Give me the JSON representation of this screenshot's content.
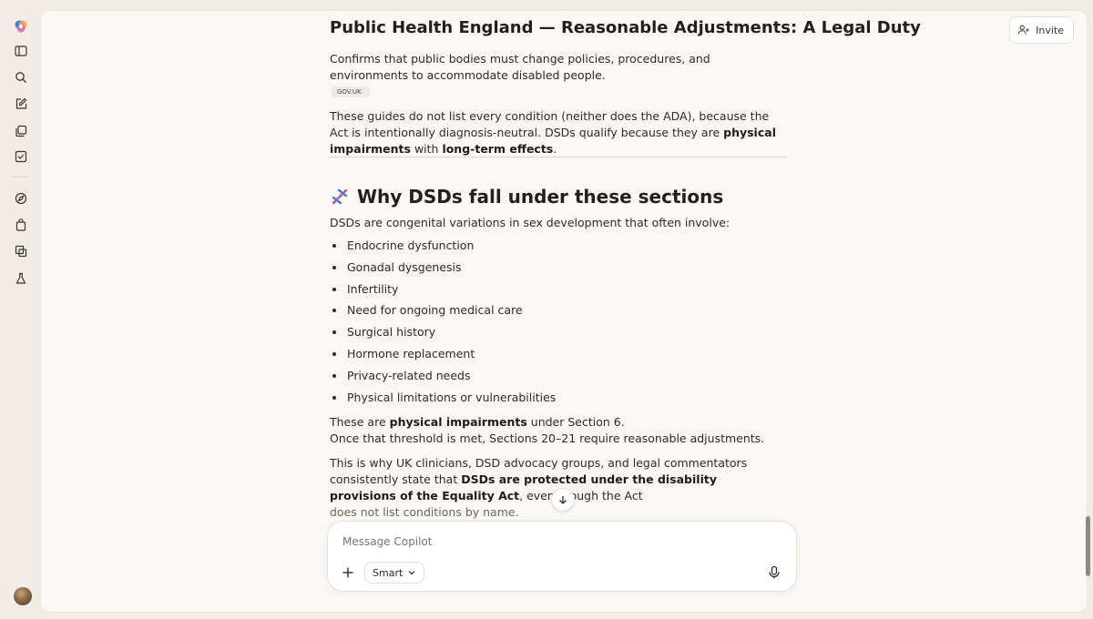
{
  "window": {
    "invite_label": "Invite"
  },
  "rail": {
    "icons": [
      "copilot-logo-icon",
      "sidebar-toggle-icon",
      "search-icon",
      "new-chat-icon",
      "library-icon",
      "tasks-icon",
      "discover-icon",
      "shopping-icon",
      "pages-icon",
      "labs-icon"
    ]
  },
  "article": {
    "heading": "Public Health England — Reasonable Adjustments: A Legal Duty",
    "para1": "Confirms that public bodies must change policies, procedures, and environments to accommodate disabled people.",
    "source_tag": "GOV.UK",
    "para2_a": "These guides do not list every condition (neither does the ADA), because the Act is intentionally diagnosis-neutral. DSDs qualify because they are ",
    "para2_b1": "physical impairments",
    "para2_c": " with ",
    "para2_b2": "long-term effects",
    "para2_d": ".",
    "section_heading": "Why DSDs fall under these sections",
    "section_intro": "DSDs are congenital variations in sex development that often involve:",
    "bullets": [
      "Endocrine dysfunction",
      "Gonadal dysgenesis",
      "Infertility",
      "Need for ongoing medical care",
      "Surgical history",
      "Hormone replacement",
      "Privacy-related needs",
      "Physical limitations or vulnerabilities"
    ],
    "para3_a": "These are ",
    "para3_b": "physical impairments",
    "para3_c": " under Section 6.",
    "para3_line2": "Once that threshold is met, Sections 20–21 require reasonable adjustments.",
    "para4_a": "This is why UK clinicians, DSD advocacy groups, and legal commentators consistently state that ",
    "para4_b": "DSDs are protected under the disability provisions of the Equality Act",
    "para4_c": ", even though the Act",
    "para4_d": "does not list conditions by name."
  },
  "composer": {
    "placeholder": "Message Copilot",
    "value": "",
    "mode_label": "Smart"
  },
  "colors": {
    "background": "#f1ece6",
    "panel": "#faf8f5",
    "text": "#2e2a26"
  }
}
